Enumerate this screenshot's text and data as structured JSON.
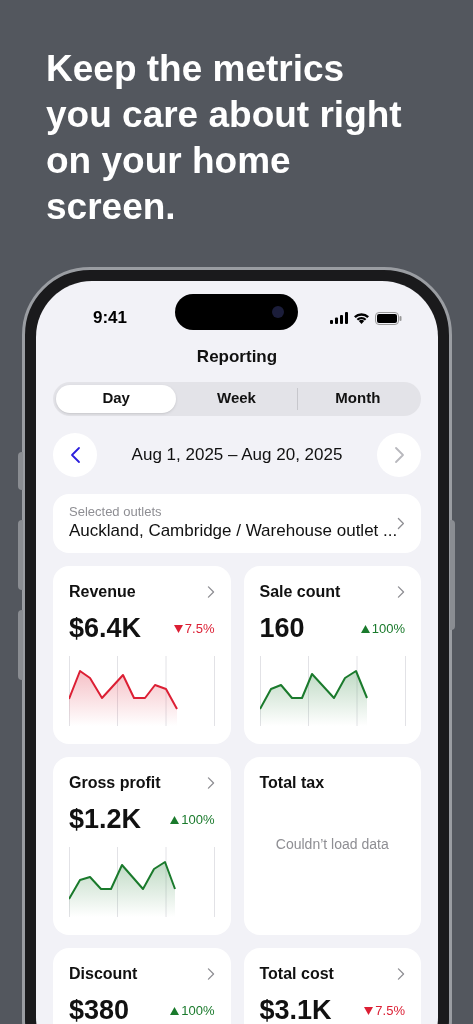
{
  "headline": "Keep the metrics\nyou care about right\non your home\nscreen.",
  "status_bar": {
    "time": "9:41"
  },
  "title": "Reporting",
  "tabs": [
    {
      "label": "Day",
      "selected": true
    },
    {
      "label": "Week",
      "selected": false
    },
    {
      "label": "Month",
      "selected": false
    }
  ],
  "date_range": {
    "label": "Aug 1, 2025 – Aug 20, 2025",
    "previous_disabled": false,
    "next_disabled": true
  },
  "outlets": {
    "label": "Selected outlets",
    "value": "Auckland, Cambridge / Warehouse outlet ..."
  },
  "cards": [
    {
      "kind": "metric",
      "title": "Revenue",
      "value": "$6.4K",
      "change": "7.5%",
      "rising": false
    },
    {
      "kind": "metric",
      "title": "Sale count",
      "value": "160",
      "change": "100%",
      "rising": true
    },
    {
      "kind": "metric",
      "title": "Gross profit",
      "value": "$1.2K",
      "change": "100%",
      "rising": true
    },
    {
      "kind": "error",
      "title": "Total tax",
      "message": "Couldn’t load data"
    },
    {
      "kind": "metric",
      "title": "Discount",
      "value": "$380",
      "change": "100%",
      "rising": true
    },
    {
      "kind": "metric",
      "title": "Total cost",
      "value": "$3.1K",
      "change": "7.5%",
      "rising": false
    }
  ]
}
